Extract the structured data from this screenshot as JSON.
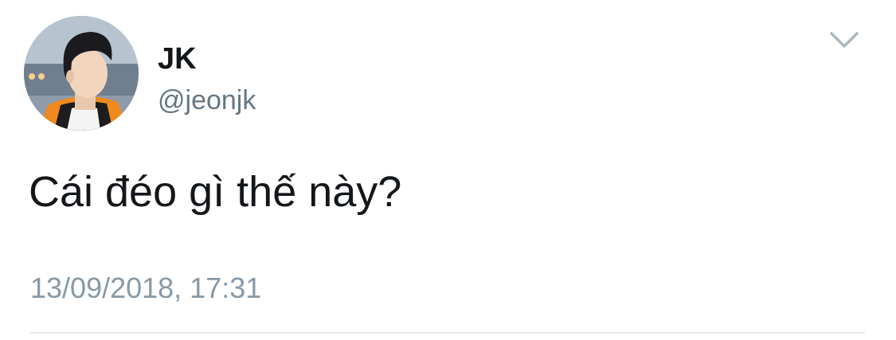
{
  "tweet": {
    "display_name": "JK",
    "handle": "@jeonjk",
    "text": "Cái đéo gì thế này?",
    "timestamp": "13/09/2018, 17:31"
  },
  "icons": {
    "menu": "chevron-down-icon"
  },
  "colors": {
    "name": "#14171a",
    "handle": "#657786",
    "timestamp": "#8899a6",
    "divider": "#e1e8ed",
    "chevron": "#aab8c2"
  }
}
